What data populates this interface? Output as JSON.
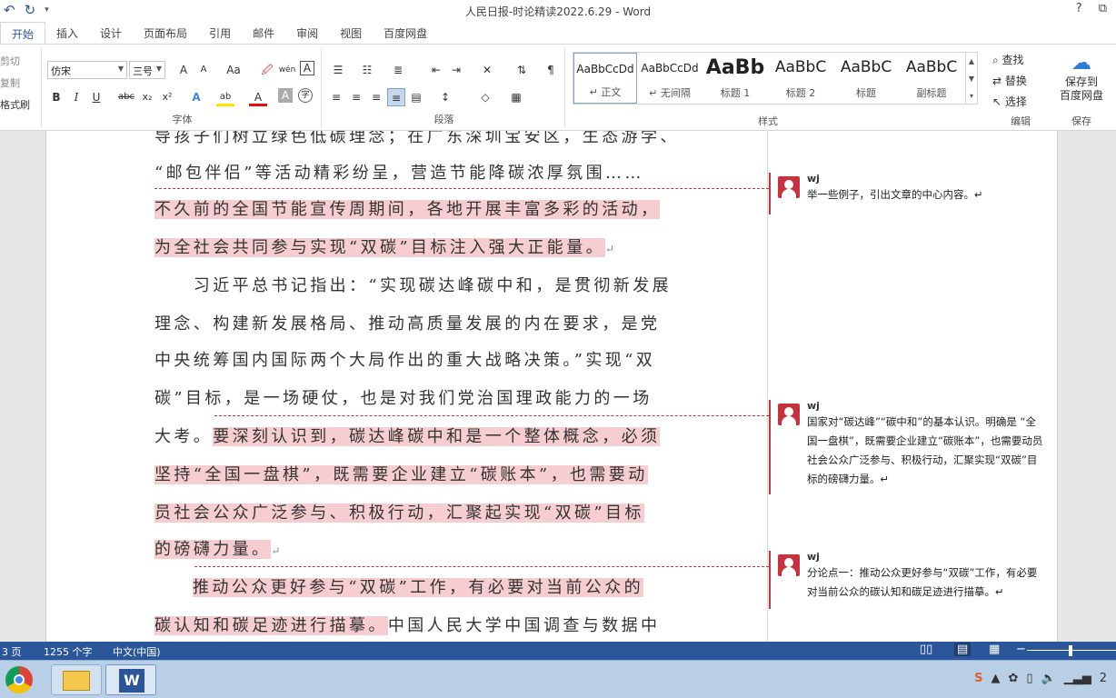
{
  "window": {
    "title": "人民日报-时论精读2022.6.29 - Word",
    "qat": {
      "undo": "↶",
      "redo": "↻",
      "more": "▾"
    },
    "controls": {
      "help": "?",
      "restore": "⧉"
    }
  },
  "tabs": [
    "开始",
    "插入",
    "设计",
    "页面布局",
    "引用",
    "邮件",
    "审阅",
    "视图",
    "百度网盘"
  ],
  "ribbon": {
    "clipboard": {
      "cut": "剪切",
      "copy": "复制",
      "format_painter": "格式刷"
    },
    "font": {
      "label": "字体",
      "font_name": "仿宋",
      "font_size": "三号",
      "bold": "B",
      "italic": "I",
      "underline": "U",
      "strike": "abc",
      "sub": "x₂",
      "sup": "x²",
      "grow": "A",
      "shrink": "A",
      "case": "Aa",
      "clear": "🖉",
      "phonetic": "wén",
      "border_char": "A",
      "text_effect": "A",
      "highlight": "ab",
      "font_color": "A",
      "shading": "A",
      "enclose": "字"
    },
    "paragraph": {
      "label": "段落"
    },
    "styles": {
      "label": "样式",
      "items": [
        {
          "sample": "AaBbCcDd",
          "name": "↵ 正文"
        },
        {
          "sample": "AaBbCcDd",
          "name": "↵ 无间隔"
        },
        {
          "sample": "AaBb",
          "name": "标题 1"
        },
        {
          "sample": "AaBbC",
          "name": "标题 2"
        },
        {
          "sample": "AaBbC",
          "name": "标题"
        },
        {
          "sample": "AaBbC",
          "name": "副标题"
        }
      ]
    },
    "editing": {
      "label": "编辑",
      "find": "查找",
      "replace": "替换",
      "select": "选择"
    },
    "save": {
      "label": "保存",
      "button": "保存到\n百度网盘"
    }
  },
  "document": {
    "lines": [
      "导孩子们树立绿色低碳理念；在广东深圳宝安区，生态游学、",
      "“邮包伴侣”等活动精彩纷呈，营造节能降碳浓厚氛围……",
      "不久前的全国节能宣传周期间，各地开展丰富多彩的活动，",
      "为全社会共同参与实现“双碳”目标注入强大正能量。",
      "　　习近平总书记指出：“实现碳达峰碳中和，是贯彻新发展",
      "理念、构建新发展格局、推动高质量发展的内在要求，是党",
      "中央统筹国内国际两个大局作出的重大战略决策。”实现“双",
      "碳”目标，是一场硬仗，也是对我们党治国理政能力的一场",
      "大考。",
      "要深刻认识到，碳达峰碳中和是一个整体概念，必须",
      "坚持“全国一盘棋”，既需要企业建立“碳账本”，也需要动",
      "员社会公众广泛参与、积极行动，汇聚起实现“双碳”目标",
      "的磅礴力量。",
      "推动公众更好参与“双碳”工作，有必要对当前公众的",
      "碳认知和碳足迹进行描摹。",
      "中国人民大学中国调查与数据中"
    ],
    "para_mark": "↵"
  },
  "comments": [
    {
      "author": "wj",
      "text": "举一些例子，引出文章的中心内容。↵"
    },
    {
      "author": "wj",
      "text": "国家对“碳达峰”“碳中和”的基本认识。明确是 “全国一盘棋”，既需要企业建立“碳账本”，也需要动员社会公众广泛参与、积极行动，汇聚实现“双碳”目标的磅礴力量。↵"
    },
    {
      "author": "wj",
      "text": "分论点一：推动公众更好参与“双碳”工作，有必要对当前公众的碳认知和碳足迹进行描摹。↵"
    }
  ],
  "status": {
    "page": "3 页",
    "words": "1255 个字",
    "lang": "中文(中国)"
  },
  "taskbar": {
    "time_partial": "2"
  }
}
